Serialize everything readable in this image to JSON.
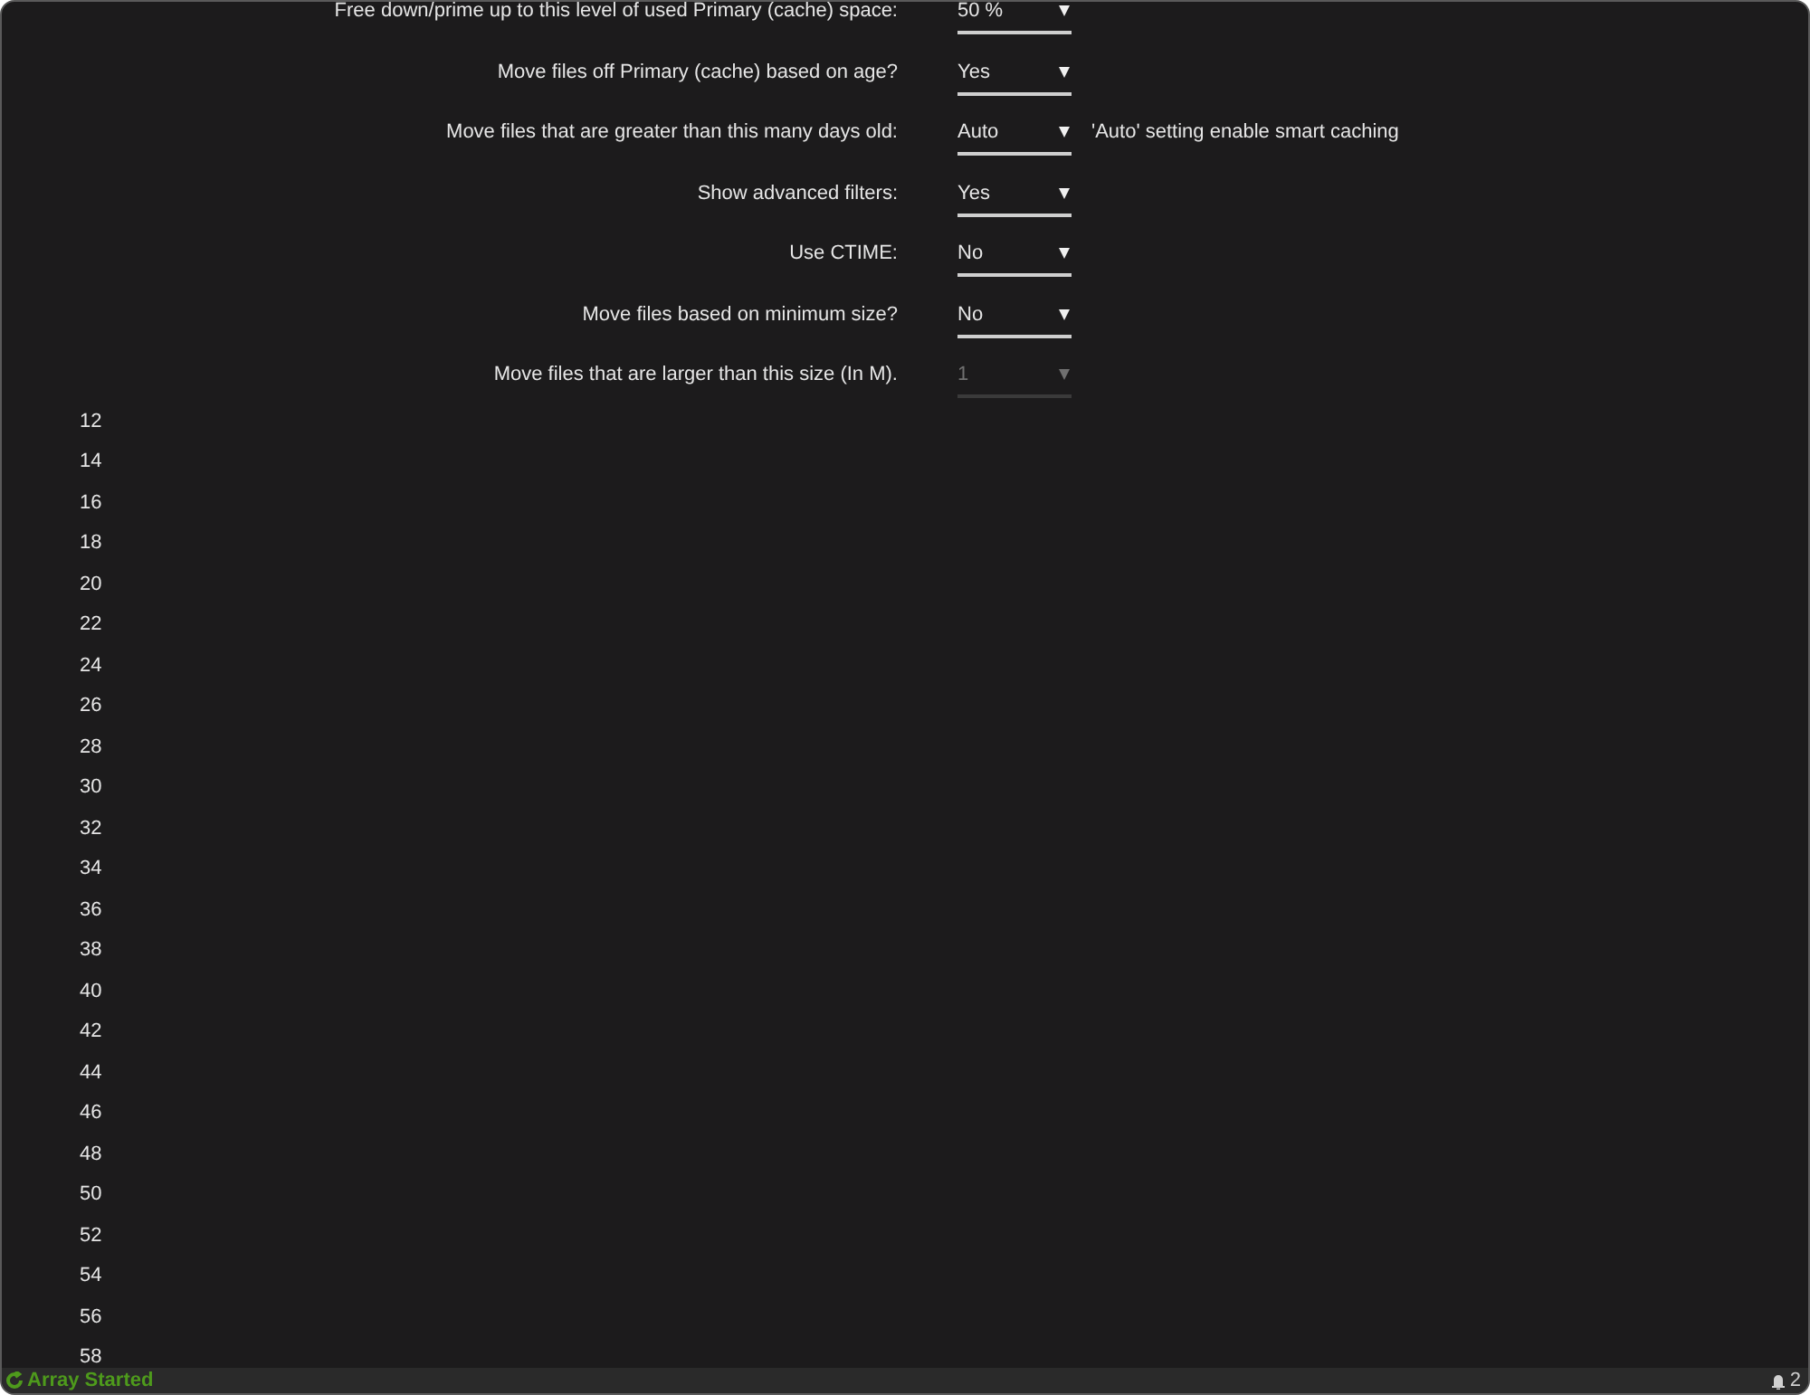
{
  "settings": [
    {
      "label": "Free down/prime up to this level of used Primary (cache) space:",
      "value": "50 %",
      "disabled": false
    },
    {
      "label": "Move files off Primary (cache) based on age?",
      "value": "Yes",
      "disabled": false
    },
    {
      "label": "Move files that are greater than this many days old:",
      "value": "Auto",
      "disabled": false,
      "note": "'Auto' setting enable smart caching"
    },
    {
      "label": "Show advanced filters:",
      "value": "Yes",
      "disabled": false
    },
    {
      "label": "Use CTIME:",
      "value": "No",
      "disabled": false
    },
    {
      "label": "Move files based on minimum size?",
      "value": "No",
      "disabled": false
    },
    {
      "label": "Move files that are larger than this size (In M).",
      "value": "1",
      "disabled": true
    }
  ],
  "numbers": [
    "12",
    "14",
    "16",
    "18",
    "20",
    "22",
    "24",
    "26",
    "28",
    "30",
    "32",
    "34",
    "36",
    "38",
    "40",
    "42",
    "44",
    "46",
    "48",
    "50",
    "52",
    "54",
    "56",
    "58"
  ],
  "status_bar": {
    "status": "Array Started",
    "count": "2"
  }
}
